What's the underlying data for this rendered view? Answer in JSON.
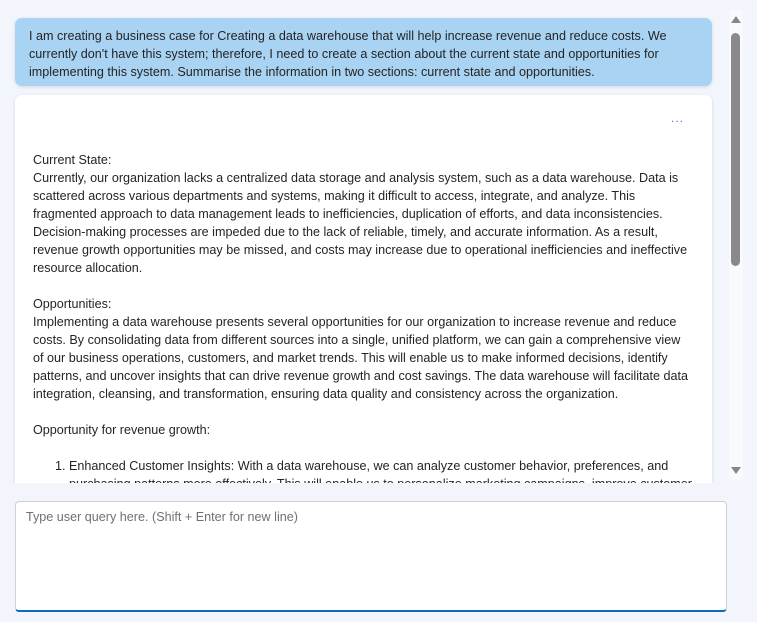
{
  "user_message": "I am creating a business case for Creating a data warehouse that will help increase revenue and reduce costs. We currently don't have this system; therefore, I need to create a section about the current state and opportunities for implementing this system. Summarise the information in two sections: current state and opportunities.",
  "response": {
    "more_label": "...",
    "current_state_heading": "Current State:",
    "current_state_text": "Currently, our organization lacks a centralized data storage and analysis system, such as a data warehouse. Data is scattered across various departments and systems, making it difficult to access, integrate, and analyze. This fragmented approach to data management leads to inefficiencies, duplication of efforts, and data inconsistencies. Decision-making processes are impeded due to the lack of reliable, timely, and accurate information. As a result, revenue growth opportunities may be missed, and costs may increase due to operational inefficiencies and ineffective resource allocation.",
    "opportunities_heading": "Opportunities:",
    "opportunities_text": "Implementing a data warehouse presents several opportunities for our organization to increase revenue and reduce costs. By consolidating data from different sources into a single, unified platform, we can gain a comprehensive view of our business operations, customers, and market trends. This will enable us to make informed decisions, identify patterns, and uncover insights that can drive revenue growth and cost savings. The data warehouse will facilitate data integration, cleansing, and transformation, ensuring data quality and consistency across the organization.",
    "revenue_heading": "Opportunity for revenue growth:",
    "list": [
      "Enhanced Customer Insights: With a data warehouse, we can analyze customer behavior, preferences, and purchasing patterns more effectively. This will enable us to personalize marketing campaigns, improve customer"
    ]
  },
  "input": {
    "placeholder": "Type user query here. (Shift + Enter for new line)",
    "value": ""
  }
}
